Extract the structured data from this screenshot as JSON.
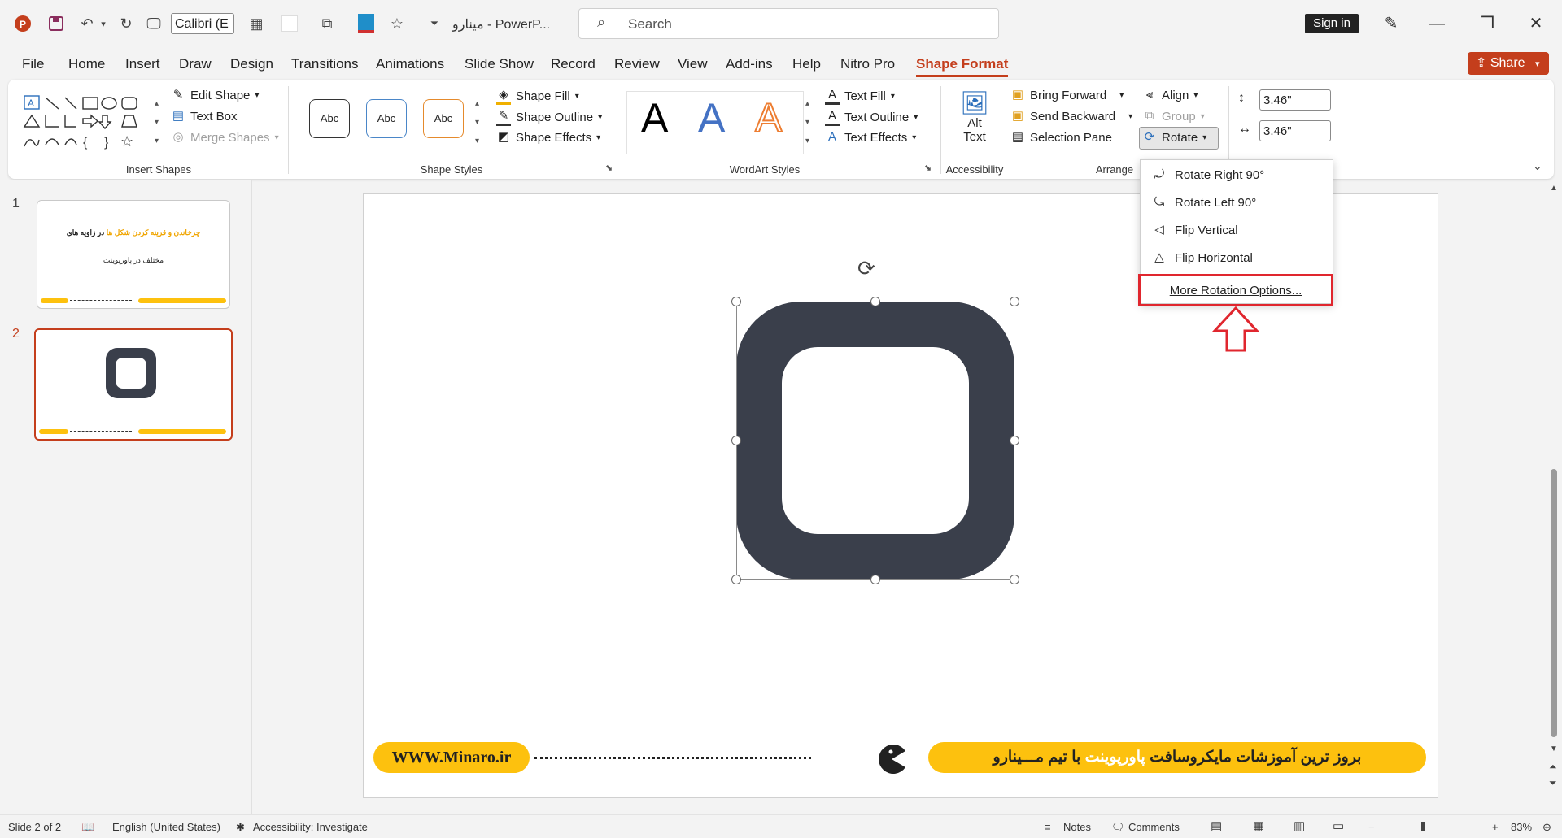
{
  "app": {
    "document_name": "مینارو",
    "app_short": "PowerP...",
    "separator": "-",
    "font_name": "Calibri (E",
    "search_placeholder": "Search",
    "sign_in": "Sign in",
    "share": "Share",
    "accent_color": "#c43e1c"
  },
  "tabs": [
    "File",
    "Home",
    "Insert",
    "Draw",
    "Design",
    "Transitions",
    "Animations",
    "Slide Show",
    "Record",
    "Review",
    "View",
    "Add-ins",
    "Help",
    "Nitro Pro",
    "Shape Format"
  ],
  "ribbon": {
    "insert_shapes": {
      "label": "Insert Shapes",
      "edit_shape": "Edit Shape",
      "text_box": "Text Box",
      "merge_shapes": "Merge Shapes"
    },
    "shape_styles": {
      "label": "Shape Styles",
      "sample": "Abc",
      "shape_fill": "Shape Fill",
      "shape_outline": "Shape Outline",
      "shape_effects": "Shape Effects"
    },
    "wordart": {
      "label": "WordArt Styles",
      "letter": "A",
      "text_fill": "Text Fill",
      "text_outline": "Text Outline",
      "text_effects": "Text Effects"
    },
    "accessibility": {
      "label": "Accessibility",
      "alt_line1": "Alt",
      "alt_line2": "Text"
    },
    "arrange": {
      "label": "Arrange",
      "bring_forward": "Bring Forward",
      "send_backward": "Send Backward",
      "selection_pane": "Selection Pane",
      "align": "Align",
      "group": "Group",
      "rotate": "Rotate"
    },
    "size": {
      "height": "3.46\"",
      "width": "3.46\""
    }
  },
  "rotate_menu": {
    "items": [
      "Rotate Right 90°",
      "Rotate Left 90°",
      "Flip Vertical",
      "Flip Horizontal",
      "More Rotation Options..."
    ]
  },
  "slides": {
    "numbers": [
      "1",
      "2"
    ],
    "thumb1_line1_a": "چرخاندن و قرینه کردن شکل ها",
    "thumb1_line1_b": "در زاویه های",
    "thumb1_line2": "مختلف در پاورپوینت"
  },
  "footer_banner": {
    "url": "WWW.Minaro.ir",
    "tagline_a": "بروز ترین آموزشات مایکروسافت",
    "tagline_b": "پاورپوینت",
    "tagline_c": "با تیم مـــینارو",
    "banner_color": "#fdc10e"
  },
  "status": {
    "slide": "Slide 2 of 2",
    "language": "English (United States)",
    "accessibility": "Accessibility: Investigate",
    "notes": "Notes",
    "comments": "Comments",
    "zoom": "83%"
  }
}
